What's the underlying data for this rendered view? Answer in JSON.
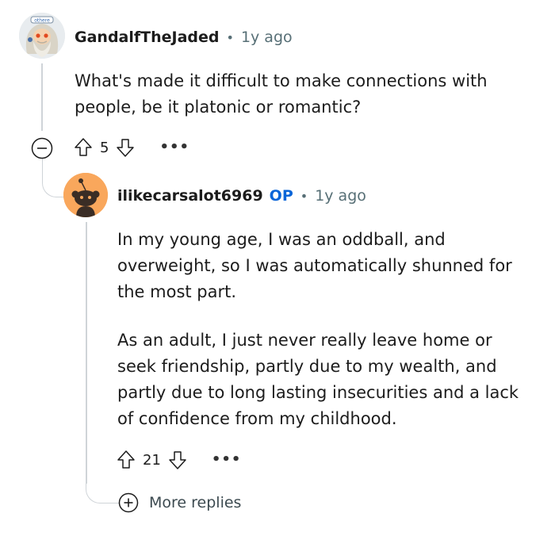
{
  "comment": {
    "username": "GandalfTheJaded",
    "separator": "•",
    "time": "1y ago",
    "text": "What's made it difficult to make connections with people, be it platonic or romantic?",
    "votes": "5",
    "more": "•••",
    "avatar_badge": "othere"
  },
  "reply": {
    "username": "ilikecarsalot6969",
    "op_badge": "OP",
    "separator": "•",
    "time": "1y ago",
    "paragraphs": [
      "In my young age, I was an oddball, and overweight, so I was automatically shunned for the most part.",
      "As an adult, I just never really leave home or seek friendship, partly due to my wealth, and partly due to long lasting insecurities and a lack of confidence from my childhood."
    ],
    "votes": "21",
    "more": "•••"
  },
  "more_replies": {
    "label": "More replies"
  }
}
